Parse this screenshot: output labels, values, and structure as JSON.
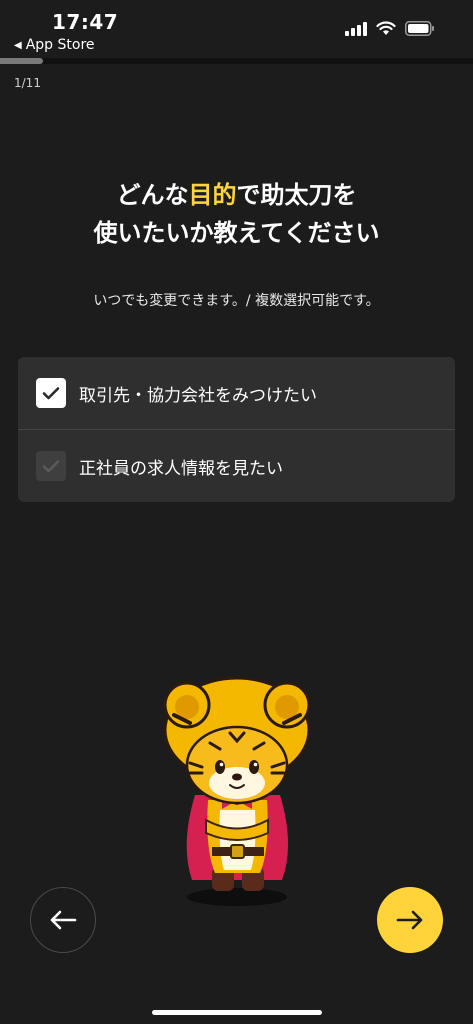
{
  "status_bar": {
    "time": "17:47",
    "back_app": "App Store",
    "signal_icon": "cellular-signal-icon",
    "wifi_icon": "wifi-icon",
    "battery_icon": "battery-icon"
  },
  "progress": {
    "step": "1/11",
    "fraction": 0.09
  },
  "heading": {
    "line1_pre": "どんな",
    "line1_accent": "目的",
    "line1_post": "で助太刀を",
    "line2": "使いたいか教えてください"
  },
  "subtext": "いつでも変更できます。/ 複数選択可能です。",
  "options": [
    {
      "label": "取引先・協力会社をみつけたい",
      "checked": true
    },
    {
      "label": "正社員の求人情報を見たい",
      "checked": false
    }
  ],
  "nav": {
    "back_icon": "arrow-left-icon",
    "next_icon": "arrow-right-icon"
  },
  "colors": {
    "background": "#1c1c1c",
    "accent": "#ffd43b",
    "card": "#2f2f2f"
  }
}
